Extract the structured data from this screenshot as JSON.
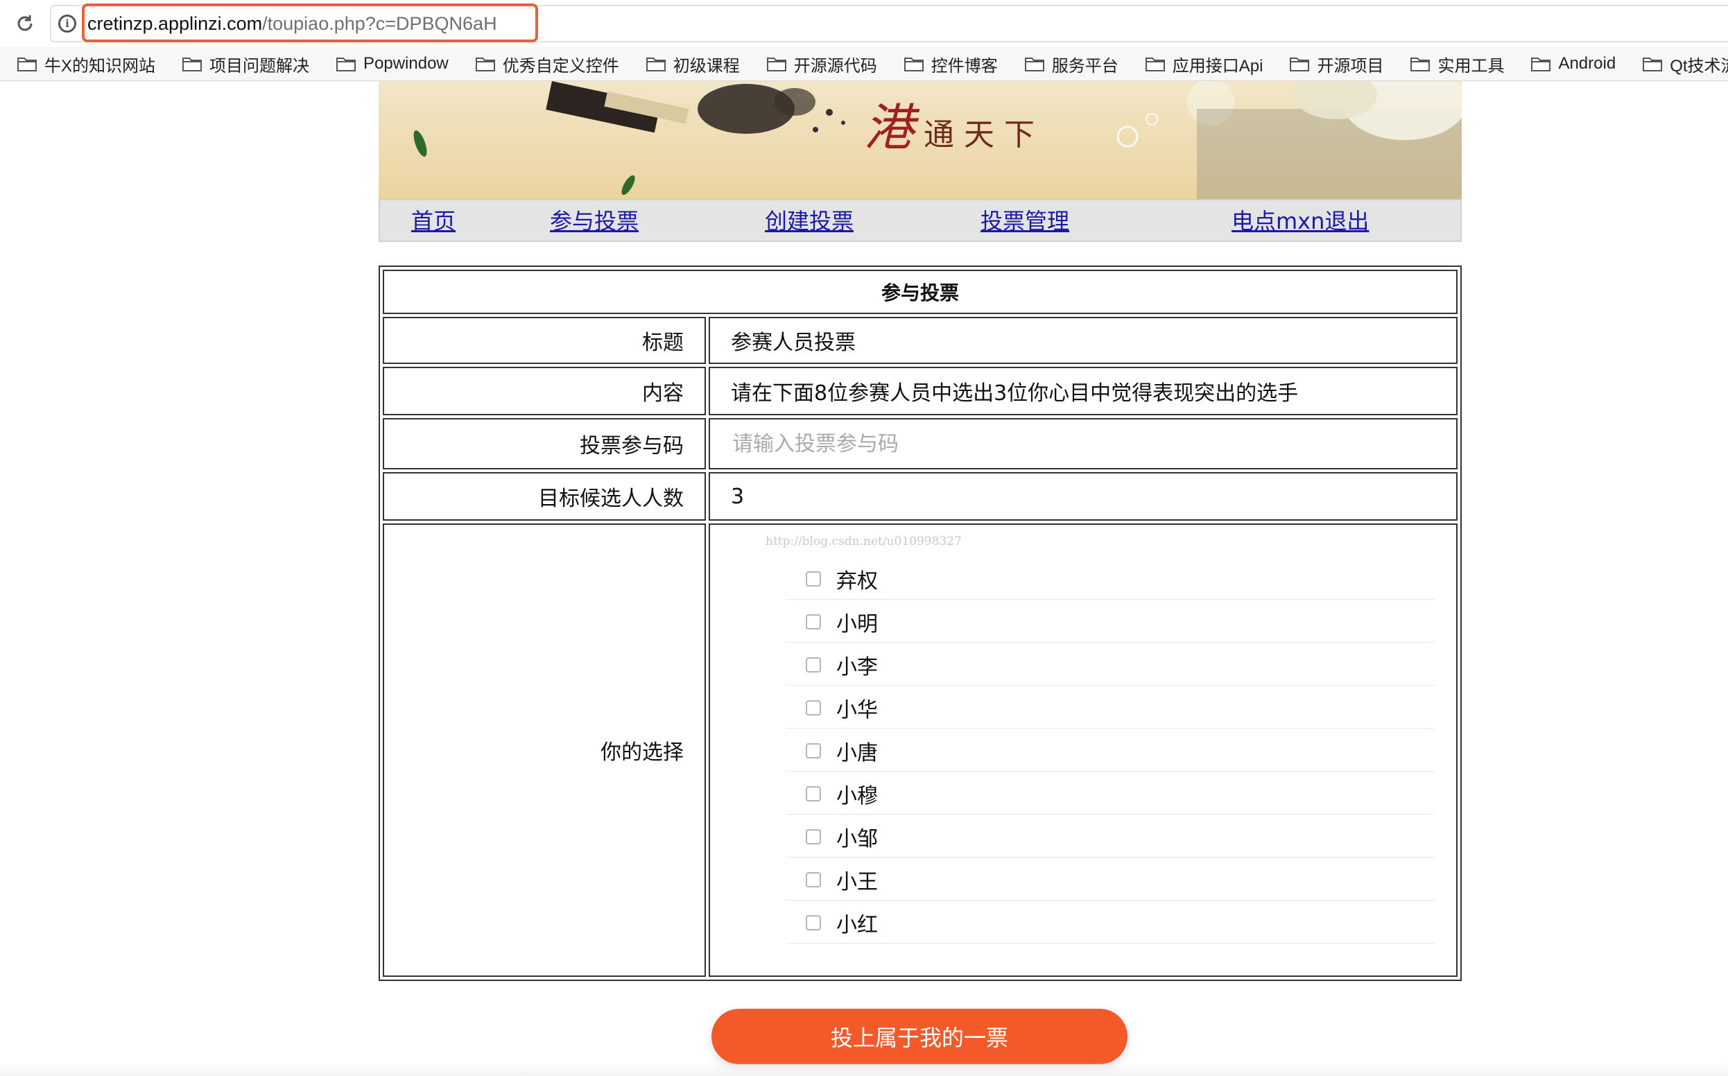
{
  "browser": {
    "url_host": "cretinzp.applinzi.com",
    "url_path": "/toupiao.php?c=DPBQN6aH"
  },
  "bookmarks": [
    {
      "label": "牛X的知识网站"
    },
    {
      "label": "项目问题解决"
    },
    {
      "label": "Popwindow"
    },
    {
      "label": "优秀自定义控件"
    },
    {
      "label": "初级课程"
    },
    {
      "label": "开源源代码"
    },
    {
      "label": "控件博客"
    },
    {
      "label": "服务平台"
    },
    {
      "label": "应用接口Api"
    },
    {
      "label": "开源项目"
    },
    {
      "label": "实用工具"
    },
    {
      "label": "Android"
    },
    {
      "label": "Qt技术流"
    }
  ],
  "banner": {
    "slogan_first": "港",
    "slogan_rest": "通天下"
  },
  "nav": {
    "home": "首页",
    "join_vote": "参与投票",
    "create_vote": "创建投票",
    "manage_vote": "投票管理",
    "logout": "电点mxn退出"
  },
  "form": {
    "heading": "参与投票",
    "title_label": "标题",
    "title_value": "参赛人员投票",
    "content_label": "内容",
    "content_value": "请在下面8位参赛人员中选出3位你心目中觉得表现突出的选手",
    "code_label": "投票参与码",
    "code_placeholder": "请输入投票参与码",
    "code_value": "",
    "target_label": "目标候选人人数",
    "target_value": "3",
    "choice_label": "你的选择",
    "watermark": "http://blog.csdn.net/u010998327",
    "candidates": [
      {
        "name": "弃权",
        "checked": false
      },
      {
        "name": "小明",
        "checked": false
      },
      {
        "name": "小李",
        "checked": false
      },
      {
        "name": "小华",
        "checked": false
      },
      {
        "name": "小唐",
        "checked": false
      },
      {
        "name": "小穆",
        "checked": false
      },
      {
        "name": "小邹",
        "checked": false
      },
      {
        "name": "小王",
        "checked": false
      },
      {
        "name": "小红",
        "checked": false
      }
    ],
    "submit_label": "投上属于我的一票"
  },
  "colors": {
    "accent": "#f45a29",
    "url_highlight": "#e8613a",
    "link": "#1a1aa6"
  }
}
